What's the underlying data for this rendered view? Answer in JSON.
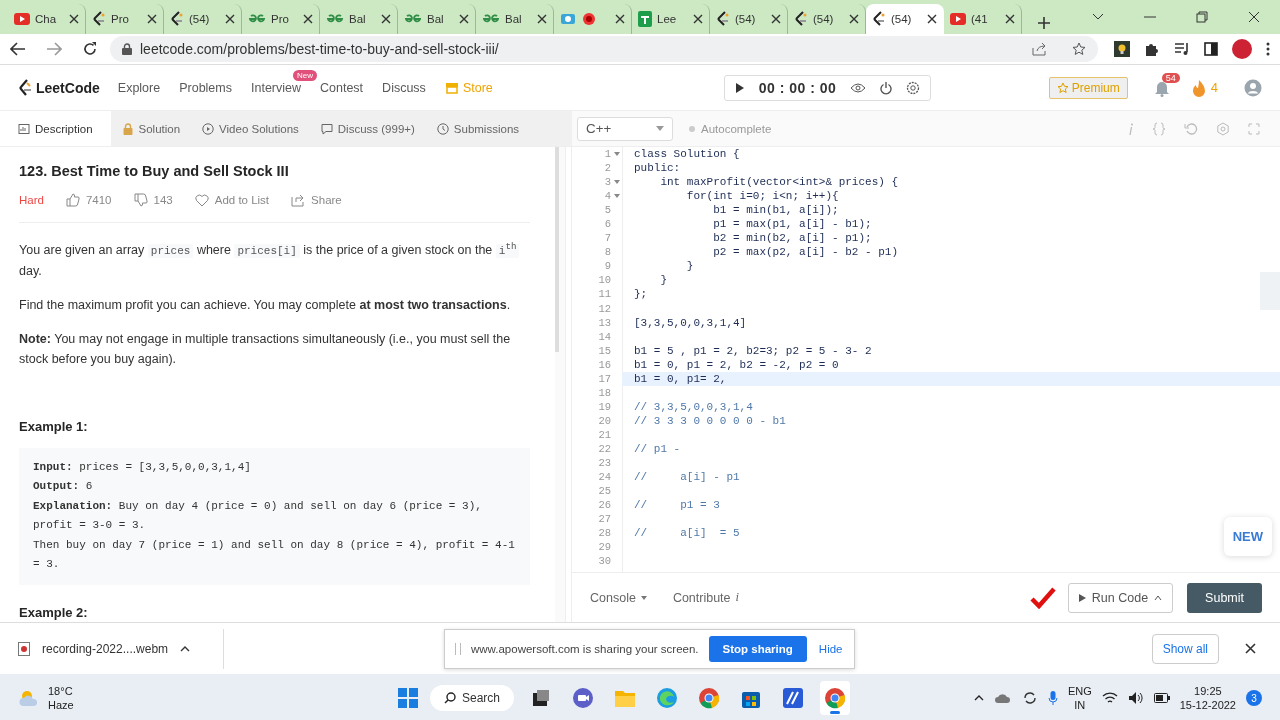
{
  "browser": {
    "tabs": [
      {
        "kind": "youtube",
        "title": "Cha",
        "selected": false
      },
      {
        "kind": "leetcode",
        "title": "Pro",
        "selected": false
      },
      {
        "kind": "leetcode",
        "title": "(54)",
        "selected": false
      },
      {
        "kind": "gfg",
        "title": "Pro",
        "selected": false
      },
      {
        "kind": "gfg",
        "title": "Bal",
        "selected": false
      },
      {
        "kind": "gfg",
        "title": "Bal",
        "selected": false
      },
      {
        "kind": "gfg",
        "title": "Bal",
        "selected": false
      },
      {
        "kind": "recorder",
        "selected": false
      },
      {
        "kind": "sheets",
        "title": "Lee",
        "selected": false
      },
      {
        "kind": "leetcode",
        "title": "(54)",
        "selected": false
      },
      {
        "kind": "leetcode",
        "title": "(54)",
        "selected": false
      },
      {
        "kind": "leetcode",
        "title": "(54)",
        "selected": true
      },
      {
        "kind": "youtube",
        "title": "(41",
        "selected": false
      }
    ],
    "address": "leetcode.com/problems/best-time-to-buy-and-sell-stock-iii/"
  },
  "nav": {
    "logo": "LeetCode",
    "links": [
      {
        "label": "Explore",
        "kind": "link"
      },
      {
        "label": "Problems",
        "kind": "link"
      },
      {
        "label": "Interview",
        "kind": "link",
        "badge": "New"
      },
      {
        "label": "Contest",
        "kind": "link"
      },
      {
        "label": "Discuss",
        "kind": "link"
      },
      {
        "label": "Store",
        "kind": "store"
      }
    ],
    "timer": "00 : 00 : 00",
    "premium": "Premium",
    "notifications": "54",
    "streak": "4"
  },
  "problem_tabs": [
    {
      "label": "Description",
      "kind": "description",
      "selected": true
    },
    {
      "label": "Solution",
      "kind": "lock",
      "selected": false
    },
    {
      "label": "Video Solutions",
      "kind": "play",
      "selected": false
    },
    {
      "label": "Discuss (999+)",
      "kind": "comment",
      "selected": false
    },
    {
      "label": "Submissions",
      "kind": "clock",
      "selected": false
    }
  ],
  "editor_toolbar": {
    "language": "C++",
    "autocomplete": "Autocomplete"
  },
  "problem": {
    "title": "123. Best Time to Buy and Sell Stock III",
    "difficulty": "Hard",
    "likes": "7410",
    "dislikes": "143",
    "add_to_list": "Add to List",
    "share": "Share",
    "paragraphs": [
      [
        {
          "kind": "text",
          "text": "You are given an array "
        },
        {
          "kind": "code",
          "text": "prices"
        },
        {
          "kind": "text",
          "text": " where "
        },
        {
          "kind": "code",
          "text": "prices[i]"
        },
        {
          "kind": "text",
          "text": " is the price of a given stock on the "
        },
        {
          "kind": "code",
          "text": "i$^{th}$"
        },
        {
          "kind": "text",
          "text": " day."
        }
      ],
      [
        {
          "kind": "text",
          "text": "Find the maximum profit you can achieve. You may complete **at most two transactions**."
        }
      ],
      [
        {
          "kind": "text",
          "text": "**Note:** You may not engage in multiple transactions simultaneously (i.e., you must sell the stock before you buy again)."
        }
      ]
    ],
    "examples": [
      {
        "heading": "Example 1:",
        "lines": [
          "**Input:** prices = [3,3,5,0,0,3,1,4]",
          "**Output:** 6",
          "**Explanation:** Buy on day 4 (price = 0) and sell on day 6 (price = 3), profit = 3-0 = 3.",
          "Then buy on day 7 (price = 1) and sell on day 8 (price = 4), profit = 4-1 = 3."
        ]
      },
      {
        "heading": "Example 2:"
      }
    ]
  },
  "code": {
    "lines": [
      {
        "n": "1",
        "text": "class Solution {",
        "kind": "code",
        "foldable": true,
        "active": false
      },
      {
        "n": "2",
        "text": "public:",
        "kind": "code",
        "foldable": false,
        "active": false
      },
      {
        "n": "3",
        "text": "    int maxProfit(vector<int>& prices) {",
        "kind": "code",
        "foldable": true,
        "active": false
      },
      {
        "n": "4",
        "text": "        for(int i=0; i<n; i++){",
        "kind": "code",
        "foldable": true,
        "active": false
      },
      {
        "n": "5",
        "text": "            b1 = min(b1, a[i]);",
        "kind": "code",
        "foldable": false,
        "active": false
      },
      {
        "n": "6",
        "text": "            p1 = max(p1, a[i] - b1);",
        "kind": "code",
        "foldable": false,
        "active": false
      },
      {
        "n": "7",
        "text": "            b2 = min(b2, a[i] - p1);",
        "kind": "code",
        "foldable": false,
        "active": false
      },
      {
        "n": "8",
        "text": "            p2 = max(p2, a[i] - b2 - p1)",
        "kind": "code",
        "foldable": false,
        "active": false
      },
      {
        "n": "9",
        "text": "        }",
        "kind": "code",
        "foldable": false,
        "active": false
      },
      {
        "n": "10",
        "text": "    }",
        "kind": "code",
        "foldable": false,
        "active": false
      },
      {
        "n": "11",
        "text": "};",
        "kind": "code",
        "foldable": false,
        "active": false
      },
      {
        "n": "12",
        "foldable": false,
        "active": false
      },
      {
        "n": "13",
        "text": "[3,3,5,0,0,3,1,4]",
        "kind": "code",
        "foldable": false,
        "active": false
      },
      {
        "n": "14",
        "foldable": false,
        "active": false
      },
      {
        "n": "15",
        "text": "b1 = 5 , p1 = 2, b2=3; p2 = 5 - 3- 2",
        "kind": "code",
        "foldable": false,
        "active": false
      },
      {
        "n": "16",
        "text": "b1 = 0, p1 = 2, b2 = -2, p2 = 0",
        "kind": "code",
        "foldable": false,
        "active": false
      },
      {
        "n": "17",
        "text": "b1 = 0, p1= 2,",
        "kind": "code",
        "foldable": false,
        "active": true
      },
      {
        "n": "18",
        "foldable": false,
        "active": false
      },
      {
        "n": "19",
        "text": "// 3,3,5,0,0,3,1,4",
        "kind": "comment",
        "foldable": false,
        "active": false
      },
      {
        "n": "20",
        "text": "// 3 3 3 0 0 0 0 0 - b1",
        "kind": "comment",
        "foldable": false,
        "active": false
      },
      {
        "n": "21",
        "foldable": false,
        "active": false
      },
      {
        "n": "22",
        "text": "// p1 -",
        "kind": "comment",
        "foldable": false,
        "active": false
      },
      {
        "n": "23",
        "foldable": false,
        "active": false
      },
      {
        "n": "24",
        "text": "//     a[i] - p1",
        "kind": "comment",
        "foldable": false,
        "active": false
      },
      {
        "n": "25",
        "foldable": false,
        "active": false
      },
      {
        "n": "26",
        "text": "//     p1 = 3",
        "kind": "comment",
        "foldable": false,
        "active": false
      },
      {
        "n": "27",
        "foldable": false,
        "active": false
      },
      {
        "n": "28",
        "text": "//     a[i]  = 5",
        "kind": "comment",
        "foldable": false,
        "active": false
      },
      {
        "n": "29",
        "foldable": false,
        "active": false
      },
      {
        "n": "30",
        "foldable": false,
        "active": false
      }
    ],
    "new_button": "NEW"
  },
  "editor_footer": {
    "console": "Console",
    "contribute": "Contribute",
    "contribute_mark": "i",
    "run": "Run Code",
    "submit": "Submit"
  },
  "download_bar": {
    "file": "recording-2022....webm",
    "sharing": "www.apowersoft.com is sharing your screen.",
    "stop": "Stop sharing",
    "hide": "Hide",
    "show_all": "Show all"
  },
  "taskbar": {
    "temperature": "18°C",
    "weather": "Haze",
    "search": "Search",
    "apps": [
      {
        "kind": "taskview",
        "active": false
      },
      {
        "kind": "meet",
        "active": false
      },
      {
        "kind": "folder",
        "active": false
      },
      {
        "kind": "edge",
        "active": false
      },
      {
        "kind": "chrome",
        "active": false
      },
      {
        "kind": "store",
        "active": false
      },
      {
        "kind": "editor",
        "active": false
      },
      {
        "kind": "chrome",
        "active": true
      }
    ],
    "language": "ENG",
    "region": "IN",
    "time": "19:25",
    "date": "15-12-2022",
    "notifications": "3"
  }
}
